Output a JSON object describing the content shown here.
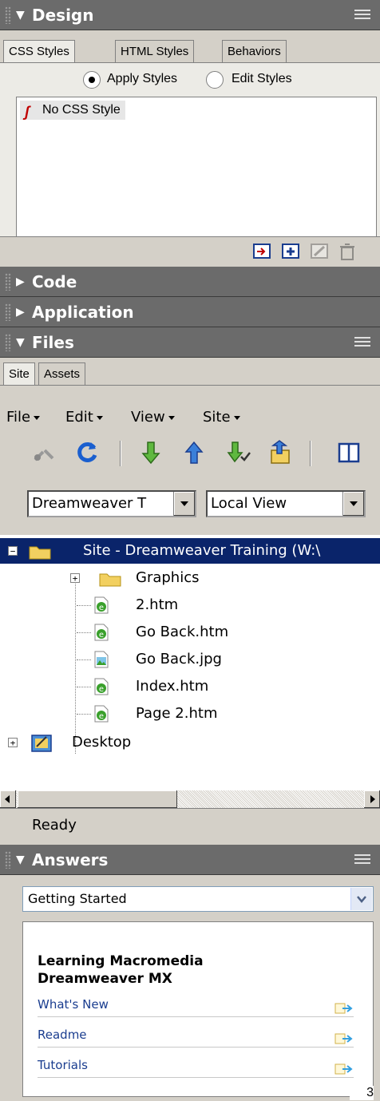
{
  "design": {
    "title": "Design",
    "tabs": [
      "CSS Styles",
      "HTML Styles",
      "Behaviors"
    ],
    "radio_apply": "Apply Styles",
    "radio_edit": "Edit Styles",
    "style_item": "No CSS Style"
  },
  "code": {
    "title": "Code"
  },
  "application": {
    "title": "Application"
  },
  "files": {
    "title": "Files",
    "tabs": [
      "Site",
      "Assets"
    ],
    "menu": [
      "File",
      "Edit",
      "View",
      "Site"
    ],
    "site_select": "Dreamweaver T",
    "view_select": "Local View",
    "tree": {
      "root": "Site - Dreamweaver Training (W:\\",
      "items": [
        "Graphics",
        "2.htm",
        "Go Back.htm",
        "Go Back.jpg",
        "Index.htm",
        "Page 2.htm"
      ],
      "desktop": "Desktop"
    },
    "status": "Ready"
  },
  "answers": {
    "title": "Answers",
    "select": "Getting Started",
    "heading_line1": "Learning Macromedia",
    "heading_line2": "Dreamweaver MX",
    "links": [
      "What's New",
      "Readme",
      "Tutorials"
    ]
  },
  "page_number": "3",
  "colors": {
    "header_bg": "#6b6b6b",
    "selection": "#0a246a",
    "panel_bg": "#d4d0c8",
    "link": "#1a3d8f"
  }
}
